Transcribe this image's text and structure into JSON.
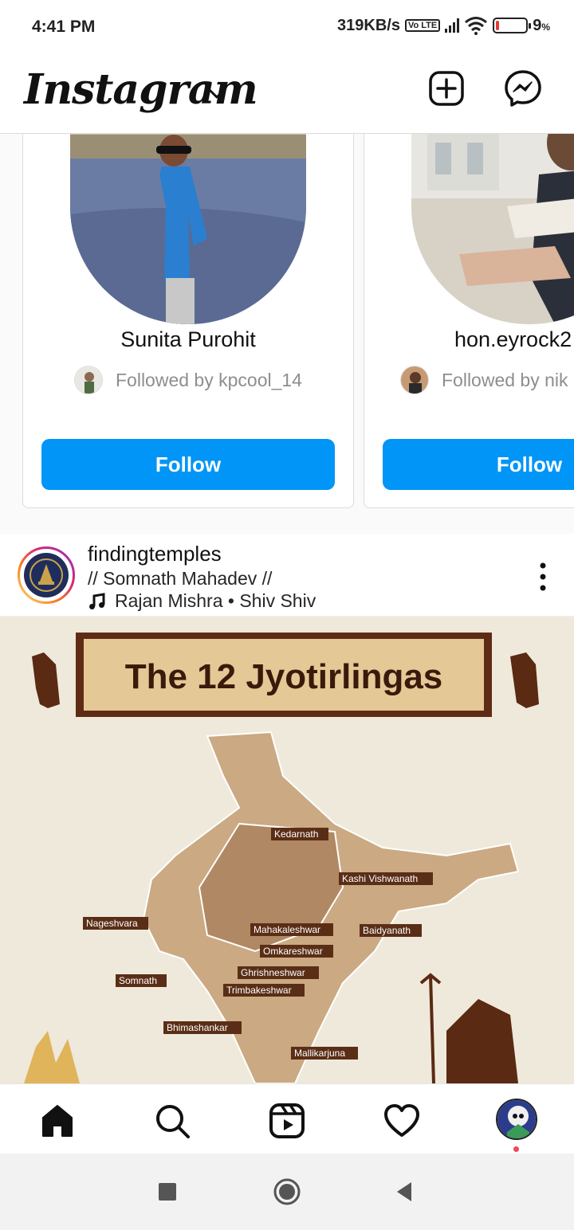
{
  "status_bar": {
    "time": "4:41 PM",
    "network_speed": "319KB/s",
    "volte": "Vo LTE",
    "battery": "9",
    "battery_unit": "%"
  },
  "header": {
    "logo_text": "Instagram",
    "icons": [
      "chevron-down-icon",
      "new-post-icon",
      "messenger-icon"
    ]
  },
  "suggestions": [
    {
      "name": "Sunita Purohit",
      "followed_by": "Followed by kpcool_14",
      "button": "Follow"
    },
    {
      "name": "hon.eyrock2",
      "followed_by": "Followed by nik",
      "button": "Follow"
    }
  ],
  "post": {
    "username": "findingtemples",
    "location": "// Somnath Mahadev //",
    "music": "Rajan Mishra • Shiv Shiv",
    "image": {
      "title": "The 12 Jyotirlingas",
      "labels": [
        "Kedarnath",
        "Kashi Vishwanath",
        "Nageshvara",
        "Mahakaleshwar",
        "Baidyanath",
        "Omkareshwar",
        "Somnath",
        "Ghrishneshwar",
        "Trimbakeshwar",
        "Bhimashankar",
        "Mallikarjuna"
      ]
    }
  },
  "bottom_nav": {
    "items": [
      "home-icon",
      "search-icon",
      "reels-icon",
      "activity-heart-icon",
      "profile-avatar"
    ],
    "notification_color": "#ed4956"
  },
  "colors": {
    "follow_button": "#0095f6",
    "map_label_bg": "#5a2e16"
  }
}
